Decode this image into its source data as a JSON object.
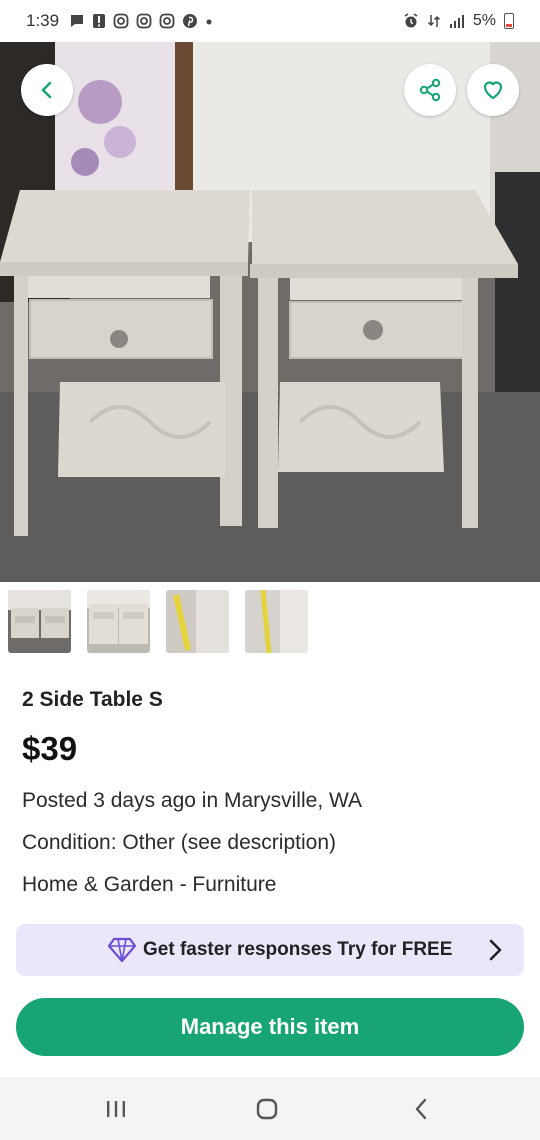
{
  "status_bar": {
    "time": "1:39",
    "battery": "5%",
    "icons": [
      "chat-icon",
      "alert-icon",
      "instagram-icon",
      "instagram-icon",
      "instagram-icon",
      "pinterest-icon",
      "dot-icon"
    ],
    "right_icons": [
      "alarm-icon",
      "data-icon",
      "signal-icon",
      "battery-icon"
    ]
  },
  "header_actions": {
    "back": "chevron-left-icon",
    "share": "share-icon",
    "favorite": "heart-icon"
  },
  "thumbnails": {
    "count": 4
  },
  "listing": {
    "title": "2 Side Table S",
    "price": "$39",
    "posted": "Posted 3 days ago in Marysville, WA",
    "condition": "Condition: Other (see description)",
    "category": "Home & Garden - Furniture"
  },
  "promo": {
    "text": "Get faster responses Try for FREE",
    "icon": "diamond-icon"
  },
  "manage_button": {
    "label": "Manage this item"
  },
  "colors": {
    "accent_green": "#17a673",
    "promo_bg": "#ece6fb",
    "promo_icon": "#6b4fd8"
  }
}
